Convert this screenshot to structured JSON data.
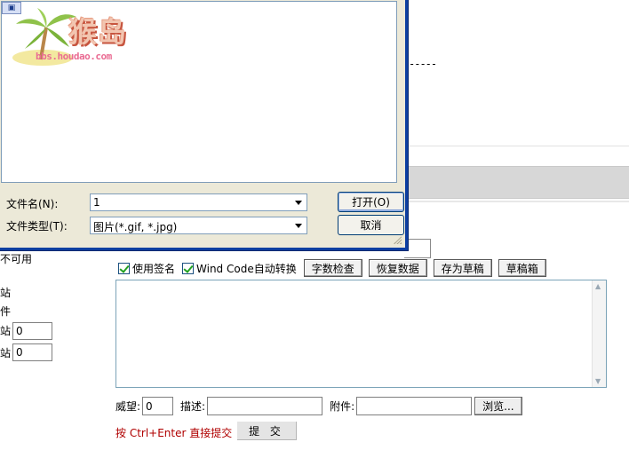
{
  "background": {
    "dashes": "-----",
    "left_labels": [
      "不可用",
      "站",
      "件",
      "站",
      "站"
    ],
    "points_inputs": [
      "0",
      "0"
    ],
    "options": {
      "use_signature": "使用签名",
      "wind_code": "Wind Code自动转换",
      "word_count_button": "字数检查",
      "restore_button": "恢复数据",
      "save_draft_button": "存为草稿",
      "draft_box_button": "草稿箱"
    },
    "bottom": {
      "prestige_label": "威望:",
      "prestige_value": "0",
      "description_label": "描述:",
      "description_value": "",
      "attachment_label": "附件:",
      "attachment_value": "",
      "browse_button": "浏览..."
    },
    "hint": "按 Ctrl+Enter 直接提交",
    "submit_button": "提 交"
  },
  "dialog": {
    "logo_text": "猴岛",
    "logo_url": "bbs.houdao.com",
    "file_name_label": "文件名(N):",
    "file_name_value": "1",
    "file_type_label": "文件类型(T):",
    "file_type_value": "图片(*.gif, *.jpg)",
    "open_button": "打开(O)",
    "cancel_button": "取消"
  },
  "colors": {
    "dialog_border": "#0d3fa1",
    "dialog_face": "#ece9d8",
    "hint_text": "#b00000"
  }
}
